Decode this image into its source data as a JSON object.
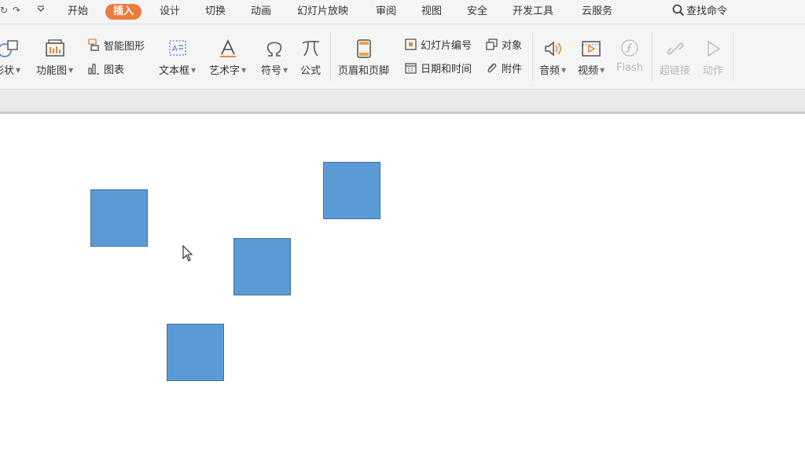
{
  "menu": {
    "items": [
      {
        "label": "开始"
      },
      {
        "label": "插入",
        "active": true
      },
      {
        "label": "设计"
      },
      {
        "label": "切换"
      },
      {
        "label": "动画"
      },
      {
        "label": "幻灯片放映"
      },
      {
        "label": "审阅"
      },
      {
        "label": "视图"
      },
      {
        "label": "安全"
      },
      {
        "label": "开发工具"
      },
      {
        "label": "云服务"
      }
    ],
    "search_label": "查找命令"
  },
  "ribbon": {
    "shape": "形状",
    "function_chart": "功能图",
    "smart_art": "智能图形",
    "chart": "图表",
    "text_box": "文本框",
    "word_art": "艺术字",
    "symbol": "符号",
    "formula": "公式",
    "header_footer": "页眉和页脚",
    "slide_number": "幻灯片编号",
    "object": "对象",
    "date_time": "日期和时间",
    "attachment": "附件",
    "audio": "音频",
    "video": "视频",
    "flash": "Flash",
    "hyperlink": "超链接",
    "action": "动作"
  },
  "colors": {
    "accent": "#ec7b3e",
    "shape_fill": "#5b9bd5",
    "shape_border": "#41719c"
  }
}
